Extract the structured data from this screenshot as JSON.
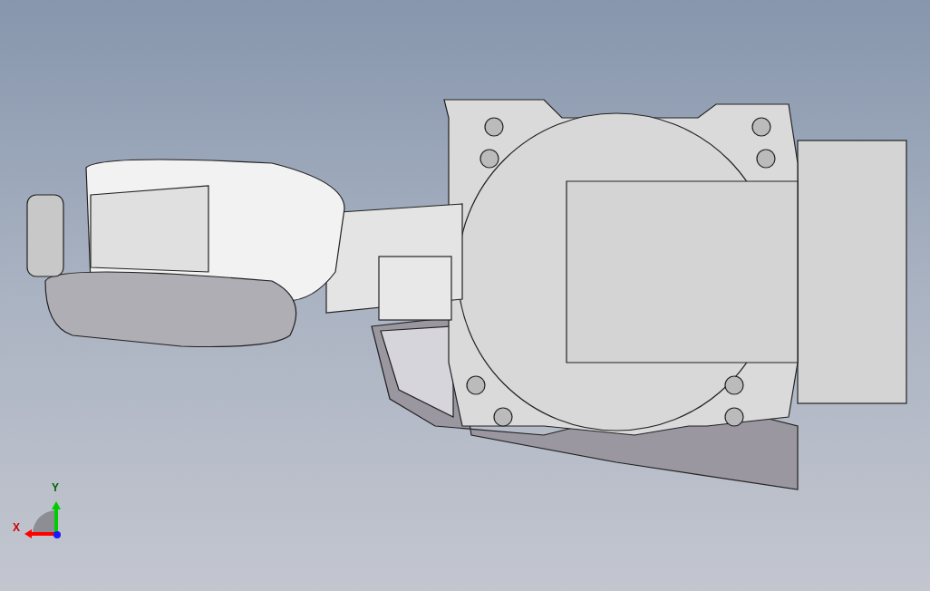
{
  "viewport": {
    "triad": {
      "axes": [
        {
          "label": "X",
          "color": "#ff0000"
        },
        {
          "label": "Y",
          "color": "#00cc00"
        }
      ]
    }
  }
}
